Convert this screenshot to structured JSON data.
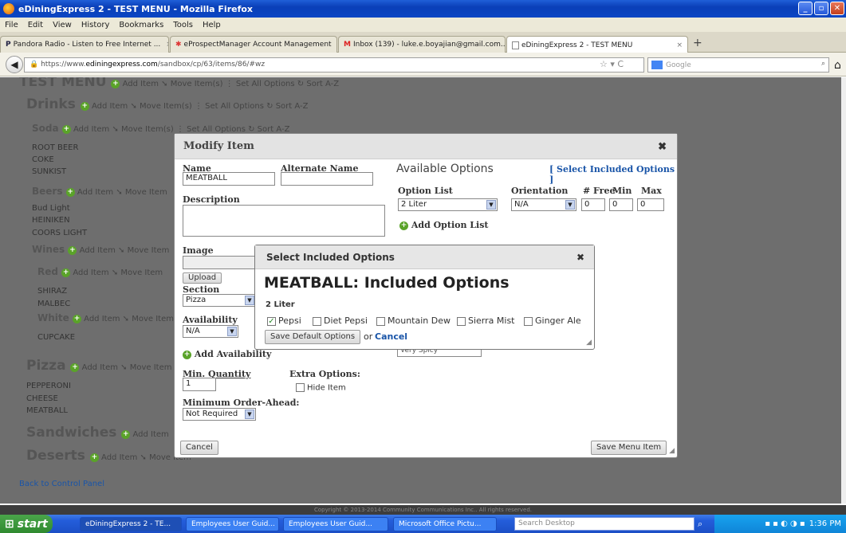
{
  "window": {
    "title": "eDiningExpress 2 - TEST MENU - Mozilla Firefox"
  },
  "menubar": [
    "File",
    "Edit",
    "View",
    "History",
    "Bookmarks",
    "Tools",
    "Help"
  ],
  "tabs": [
    {
      "label": "Pandora Radio - Listen to Free Internet ...",
      "icon": "P"
    },
    {
      "label": "eProspectManager Account Management",
      "icon": "figure"
    },
    {
      "label": "Inbox (139) - luke.e.boyajian@gmail.com...",
      "icon": "M"
    },
    {
      "label": "eDiningExpress 2 - TEST MENU",
      "icon": "page"
    }
  ],
  "url": {
    "prefix": "https://www.",
    "domain": "ediningexpress.com",
    "path": "/sandbox/cp/63/items/86/#wz"
  },
  "search": {
    "placeholder": "Google"
  },
  "menu": {
    "top_title": "TEST MENU",
    "drinks": "Drinks",
    "soda": "Soda",
    "soda_items": [
      "ROOT BEER",
      "COKE",
      "SUNKIST"
    ],
    "beers": "Beers",
    "beer_items": [
      "Bud Light",
      "HEINIKEN",
      "COORS LIGHT"
    ],
    "wines": "Wines",
    "red": "Red",
    "red_items": [
      "SHIRAZ",
      "MALBEC"
    ],
    "white": "White",
    "white_items": [
      "CUPCAKE"
    ],
    "pizza": "Pizza",
    "pizza_items": [
      "PEPPERONI",
      "CHEESE",
      "MEATBALL"
    ],
    "sandwiches": "Sandwiches",
    "deserts": "Deserts",
    "add_item": "Add Item",
    "move_items": "Move Item(s)",
    "move_item_trunc": "Move Item",
    "set_all": "Set All Options",
    "sort": "Sort A-Z",
    "back": "Back to Control Panel"
  },
  "modify": {
    "title": "Modify Item",
    "name_label": "Name",
    "name_value": "MEATBALL",
    "alt_label": "Alternate Name",
    "alt_value": "",
    "desc_label": "Description",
    "image_label": "Image",
    "upload": "Upload",
    "section_label": "Section",
    "section_value": "Pizza",
    "availability_label": "Availability",
    "availability_value": "N/A",
    "add_availability": "Add Availability",
    "min_qty_label": "Min. Quantity",
    "min_qty_value": "1",
    "extra_label": "Extra Options:",
    "hide_item": "Hide Item",
    "min_order_label": "Minimum Order-Ahead:",
    "min_order_value": "Not Required",
    "avail_options": "Available Options",
    "select_included": "[ Select Included Options ]",
    "option_list_label": "Option List",
    "option_list_value": "2 Liter",
    "orientation_label": "Orientation",
    "orientation_value": "N/A",
    "free_label": "# Free",
    "free_value": "0",
    "min_label": "Min",
    "min_value": "0",
    "max_label": "Max",
    "max_value": "0",
    "add_option_list": "Add Option List",
    "spicy": "Very Spicy",
    "cancel": "Cancel",
    "save": "Save Menu Item"
  },
  "included": {
    "title": "Select Included Options",
    "heading": "MEATBALL: Included Options",
    "group": "2 Liter",
    "options": [
      {
        "label": "Pepsi",
        "checked": true
      },
      {
        "label": "Diet Pepsi",
        "checked": false
      },
      {
        "label": "Mountain Dew",
        "checked": false
      },
      {
        "label": "Sierra Mist",
        "checked": false
      },
      {
        "label": "Ginger Ale",
        "checked": false
      }
    ],
    "save": "Save Default Options",
    "or": "or",
    "cancel": "Cancel"
  },
  "footer": "Copyright © 2013-2014 Community Communications Inc.. All rights reserved.",
  "taskbar": {
    "start": "start",
    "buttons": [
      "eDiningExpress 2 - TE...",
      "Employees User Guid...",
      "Employees User Guid...",
      "Microsoft Office Pictu..."
    ],
    "search": "Search Desktop",
    "clock": "1:36 PM"
  },
  "colors": {
    "accent": "#1a55a8",
    "plus": "#5aa329",
    "titlebar": "#0a3fb8"
  }
}
